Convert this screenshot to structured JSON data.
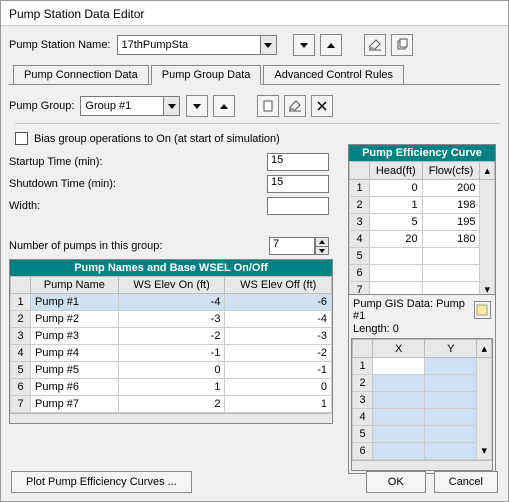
{
  "window": {
    "title": "Pump Station Data Editor"
  },
  "header": {
    "name_label": "Pump Station Name:",
    "name_value": "17thPumpSta"
  },
  "tabs": {
    "t1": "Pump Connection Data",
    "t2": "Pump Group Data",
    "t3": "Advanced Control Rules"
  },
  "group": {
    "label": "Pump Group:",
    "value": "Group #1",
    "bias_label": "Bias group operations to On (at start of simulation)",
    "startup_label": "Startup Time (min):",
    "startup_value": "15",
    "shutdown_label": "Shutdown Time (min):",
    "shutdown_value": "15",
    "width_label": "Width:",
    "width_value": "",
    "numpumps_label": "Number of pumps in this group:",
    "numpumps_value": "7"
  },
  "eff": {
    "title": "Pump Efficiency Curve",
    "col1": "Head(ft)",
    "col2": "Flow(cfs)",
    "rows": [
      {
        "r": "1",
        "h": "0",
        "f": "200"
      },
      {
        "r": "2",
        "h": "1",
        "f": "198"
      },
      {
        "r": "3",
        "h": "5",
        "f": "195"
      },
      {
        "r": "4",
        "h": "20",
        "f": "180"
      },
      {
        "r": "5",
        "h": "",
        "f": ""
      },
      {
        "r": "6",
        "h": "",
        "f": ""
      },
      {
        "r": "7",
        "h": "",
        "f": ""
      }
    ]
  },
  "pumps": {
    "title": "Pump Names and Base WSEL On/Off",
    "col1": "Pump Name",
    "col2": "WS Elev On (ft)",
    "col3": "WS Elev Off (ft)",
    "rows": [
      {
        "r": "1",
        "n": "Pump #1",
        "on": "-4",
        "off": "-6"
      },
      {
        "r": "2",
        "n": "Pump #2",
        "on": "-3",
        "off": "-4"
      },
      {
        "r": "3",
        "n": "Pump #3",
        "on": "-2",
        "off": "-3"
      },
      {
        "r": "4",
        "n": "Pump #4",
        "on": "-1",
        "off": "-2"
      },
      {
        "r": "5",
        "n": "Pump #5",
        "on": "0",
        "off": "-1"
      },
      {
        "r": "6",
        "n": "Pump #6",
        "on": "1",
        "off": "0"
      },
      {
        "r": "7",
        "n": "Pump #7",
        "on": "2",
        "off": "1"
      }
    ]
  },
  "gis": {
    "title": "Pump GIS Data: Pump #1",
    "length": "Length: 0",
    "colx": "X",
    "coly": "Y"
  },
  "footer": {
    "plot": "Plot Pump Efficiency Curves ...",
    "ok": "OK",
    "cancel": "Cancel"
  }
}
